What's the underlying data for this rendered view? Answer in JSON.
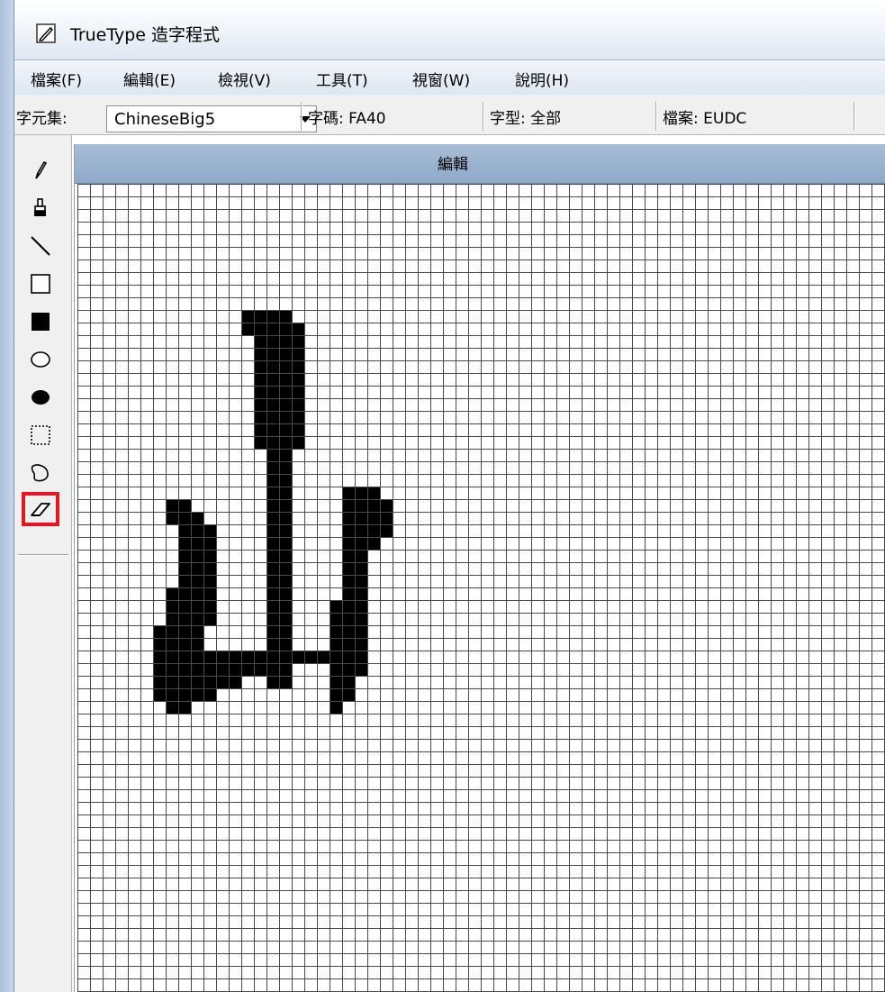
{
  "window": {
    "title": "TrueType 造字程式",
    "app_icon": "pen-edit-icon"
  },
  "menu": [
    {
      "label": "檔案(F)"
    },
    {
      "label": "編輯(E)"
    },
    {
      "label": "檢視(V)"
    },
    {
      "label": "工具(T)"
    },
    {
      "label": "視窗(W)"
    },
    {
      "label": "說明(H)"
    }
  ],
  "toolbar": {
    "charset_label": "字元集:",
    "charset_value": "ChineseBig5",
    "code_label": "字碼: FA40",
    "font_label": "字型: 全部",
    "file_label": "檔案: EUDC"
  },
  "tools": [
    {
      "name": "pencil-icon",
      "selected": false
    },
    {
      "name": "brush-icon",
      "selected": false
    },
    {
      "name": "line-icon",
      "selected": false
    },
    {
      "name": "hollow-rectangle-icon",
      "selected": false
    },
    {
      "name": "filled-rectangle-icon",
      "selected": false
    },
    {
      "name": "hollow-ellipse-icon",
      "selected": false
    },
    {
      "name": "filled-ellipse-icon",
      "selected": false
    },
    {
      "name": "rectangular-select-icon",
      "selected": false
    },
    {
      "name": "freeform-select-icon",
      "selected": false
    },
    {
      "name": "eraser-icon",
      "selected": true
    }
  ],
  "editor": {
    "title": "編輯",
    "grid_columns": 64,
    "grid_rows": 64,
    "filled_cells": [
      [
        13,
        10
      ],
      [
        14,
        10
      ],
      [
        15,
        10
      ],
      [
        16,
        10
      ],
      [
        13,
        11
      ],
      [
        14,
        11
      ],
      [
        15,
        11
      ],
      [
        16,
        11
      ],
      [
        17,
        11
      ],
      [
        14,
        12
      ],
      [
        15,
        12
      ],
      [
        16,
        12
      ],
      [
        17,
        12
      ],
      [
        14,
        13
      ],
      [
        15,
        13
      ],
      [
        16,
        13
      ],
      [
        17,
        13
      ],
      [
        14,
        14
      ],
      [
        15,
        14
      ],
      [
        16,
        14
      ],
      [
        17,
        14
      ],
      [
        14,
        15
      ],
      [
        15,
        15
      ],
      [
        16,
        15
      ],
      [
        17,
        15
      ],
      [
        14,
        16
      ],
      [
        15,
        16
      ],
      [
        16,
        16
      ],
      [
        17,
        16
      ],
      [
        14,
        17
      ],
      [
        15,
        17
      ],
      [
        16,
        17
      ],
      [
        17,
        17
      ],
      [
        14,
        18
      ],
      [
        15,
        18
      ],
      [
        16,
        18
      ],
      [
        17,
        18
      ],
      [
        14,
        19
      ],
      [
        15,
        19
      ],
      [
        16,
        19
      ],
      [
        17,
        19
      ],
      [
        14,
        20
      ],
      [
        15,
        20
      ],
      [
        16,
        20
      ],
      [
        17,
        20
      ],
      [
        15,
        21
      ],
      [
        16,
        21
      ],
      [
        15,
        22
      ],
      [
        16,
        22
      ],
      [
        15,
        23
      ],
      [
        16,
        23
      ],
      [
        15,
        24
      ],
      [
        16,
        24
      ],
      [
        15,
        25
      ],
      [
        16,
        25
      ],
      [
        15,
        26
      ],
      [
        15,
        27
      ],
      [
        15,
        28
      ],
      [
        15,
        29
      ],
      [
        15,
        30
      ],
      [
        15,
        31
      ],
      [
        15,
        32
      ],
      [
        15,
        33
      ],
      [
        15,
        34
      ],
      [
        15,
        35
      ],
      [
        15,
        36
      ],
      [
        15,
        37
      ],
      [
        15,
        38
      ],
      [
        15,
        39
      ],
      [
        16,
        26
      ],
      [
        16,
        27
      ],
      [
        16,
        28
      ],
      [
        16,
        29
      ],
      [
        16,
        30
      ],
      [
        16,
        31
      ],
      [
        16,
        32
      ],
      [
        16,
        33
      ],
      [
        16,
        34
      ],
      [
        16,
        35
      ],
      [
        16,
        36
      ],
      [
        16,
        37
      ],
      [
        16,
        38
      ],
      [
        16,
        39
      ],
      [
        21,
        24
      ],
      [
        22,
        24
      ],
      [
        23,
        24
      ],
      [
        21,
        25
      ],
      [
        22,
        25
      ],
      [
        23,
        25
      ],
      [
        24,
        25
      ],
      [
        21,
        26
      ],
      [
        22,
        26
      ],
      [
        23,
        26
      ],
      [
        24,
        26
      ],
      [
        21,
        27
      ],
      [
        22,
        27
      ],
      [
        23,
        27
      ],
      [
        24,
        27
      ],
      [
        21,
        28
      ],
      [
        22,
        28
      ],
      [
        23,
        28
      ],
      [
        21,
        29
      ],
      [
        22,
        29
      ],
      [
        21,
        30
      ],
      [
        22,
        30
      ],
      [
        21,
        31
      ],
      [
        22,
        31
      ],
      [
        21,
        32
      ],
      [
        22,
        32
      ],
      [
        20,
        33
      ],
      [
        21,
        33
      ],
      [
        22,
        33
      ],
      [
        20,
        34
      ],
      [
        21,
        34
      ],
      [
        22,
        34
      ],
      [
        20,
        35
      ],
      [
        21,
        35
      ],
      [
        22,
        35
      ],
      [
        20,
        36
      ],
      [
        21,
        36
      ],
      [
        22,
        36
      ],
      [
        20,
        37
      ],
      [
        21,
        37
      ],
      [
        22,
        37
      ],
      [
        20,
        38
      ],
      [
        21,
        38
      ],
      [
        22,
        38
      ],
      [
        20,
        39
      ],
      [
        21,
        39
      ],
      [
        20,
        40
      ],
      [
        21,
        40
      ],
      [
        20,
        41
      ],
      [
        7,
        25
      ],
      [
        8,
        25
      ],
      [
        7,
        26
      ],
      [
        8,
        26
      ],
      [
        9,
        26
      ],
      [
        8,
        27
      ],
      [
        9,
        27
      ],
      [
        10,
        27
      ],
      [
        8,
        28
      ],
      [
        9,
        28
      ],
      [
        10,
        28
      ],
      [
        8,
        29
      ],
      [
        9,
        29
      ],
      [
        10,
        29
      ],
      [
        8,
        30
      ],
      [
        9,
        30
      ],
      [
        10,
        30
      ],
      [
        8,
        31
      ],
      [
        9,
        31
      ],
      [
        10,
        31
      ],
      [
        7,
        32
      ],
      [
        8,
        32
      ],
      [
        9,
        32
      ],
      [
        10,
        32
      ],
      [
        7,
        33
      ],
      [
        8,
        33
      ],
      [
        9,
        33
      ],
      [
        10,
        33
      ],
      [
        7,
        34
      ],
      [
        8,
        34
      ],
      [
        9,
        34
      ],
      [
        10,
        34
      ],
      [
        6,
        35
      ],
      [
        7,
        35
      ],
      [
        8,
        35
      ],
      [
        9,
        35
      ],
      [
        6,
        36
      ],
      [
        7,
        36
      ],
      [
        8,
        36
      ],
      [
        9,
        36
      ],
      [
        6,
        37
      ],
      [
        7,
        37
      ],
      [
        8,
        37
      ],
      [
        9,
        37
      ],
      [
        10,
        37
      ],
      [
        11,
        37
      ],
      [
        12,
        37
      ],
      [
        13,
        37
      ],
      [
        14,
        37
      ],
      [
        15,
        37
      ],
      [
        16,
        37
      ],
      [
        17,
        37
      ],
      [
        18,
        37
      ],
      [
        19,
        37
      ],
      [
        20,
        37
      ],
      [
        6,
        38
      ],
      [
        7,
        38
      ],
      [
        8,
        38
      ],
      [
        9,
        38
      ],
      [
        10,
        38
      ],
      [
        11,
        38
      ],
      [
        12,
        38
      ],
      [
        13,
        38
      ],
      [
        14,
        38
      ],
      [
        6,
        39
      ],
      [
        7,
        39
      ],
      [
        8,
        39
      ],
      [
        9,
        39
      ],
      [
        10,
        39
      ],
      [
        11,
        39
      ],
      [
        12,
        39
      ],
      [
        6,
        40
      ],
      [
        7,
        40
      ],
      [
        8,
        40
      ],
      [
        9,
        40
      ],
      [
        10,
        40
      ],
      [
        7,
        41
      ],
      [
        8,
        41
      ]
    ]
  }
}
